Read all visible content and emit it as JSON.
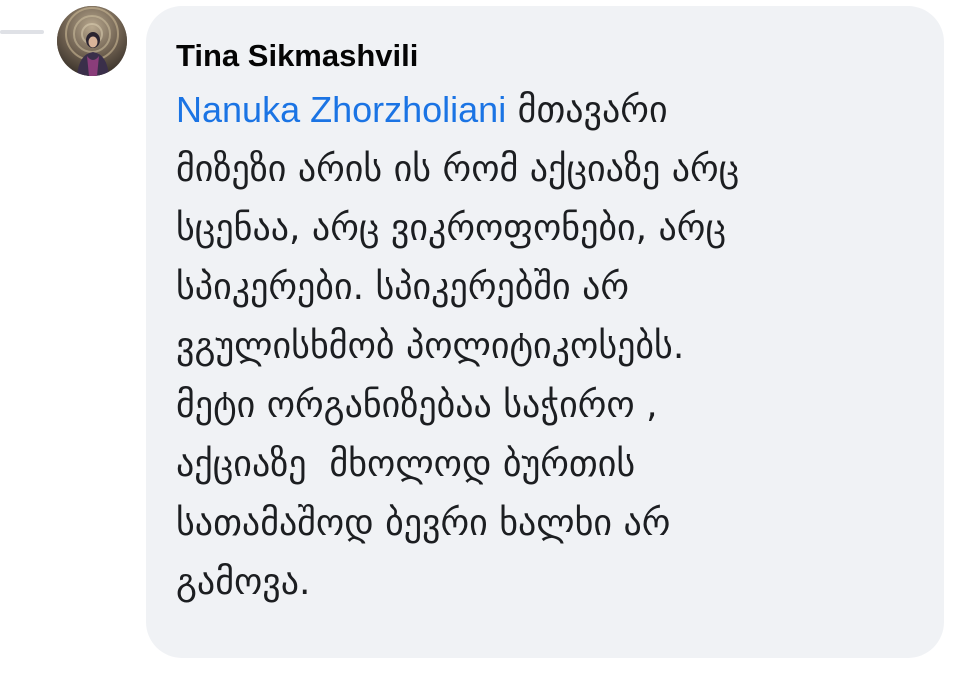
{
  "comment": {
    "author": "Tina Sikmashvili",
    "mention": "Nanuka Zhorzholiani",
    "lines": [
      " მთავარი",
      "მიზეზი არის ის რომ აქციაზე არც",
      "სცენაა, არც ვიკროფონები, არც",
      "სპიკერები. სპიკერებში არ",
      "ვგულისხმობ პოლიტიკოსებს.",
      "მეტი ორგანიზებაა საჭირო ,",
      "აქციაზე  მხოლოდ ბურთის",
      "სათამაშოდ ბევრი ხალხი არ",
      "გამოვა."
    ]
  },
  "colors": {
    "bubble_bg": "#f0f2f5",
    "mention": "#1b74e4",
    "author": "#050505",
    "text": "#1c1e21"
  },
  "icons": {
    "avatar": "user-profile-photo"
  }
}
